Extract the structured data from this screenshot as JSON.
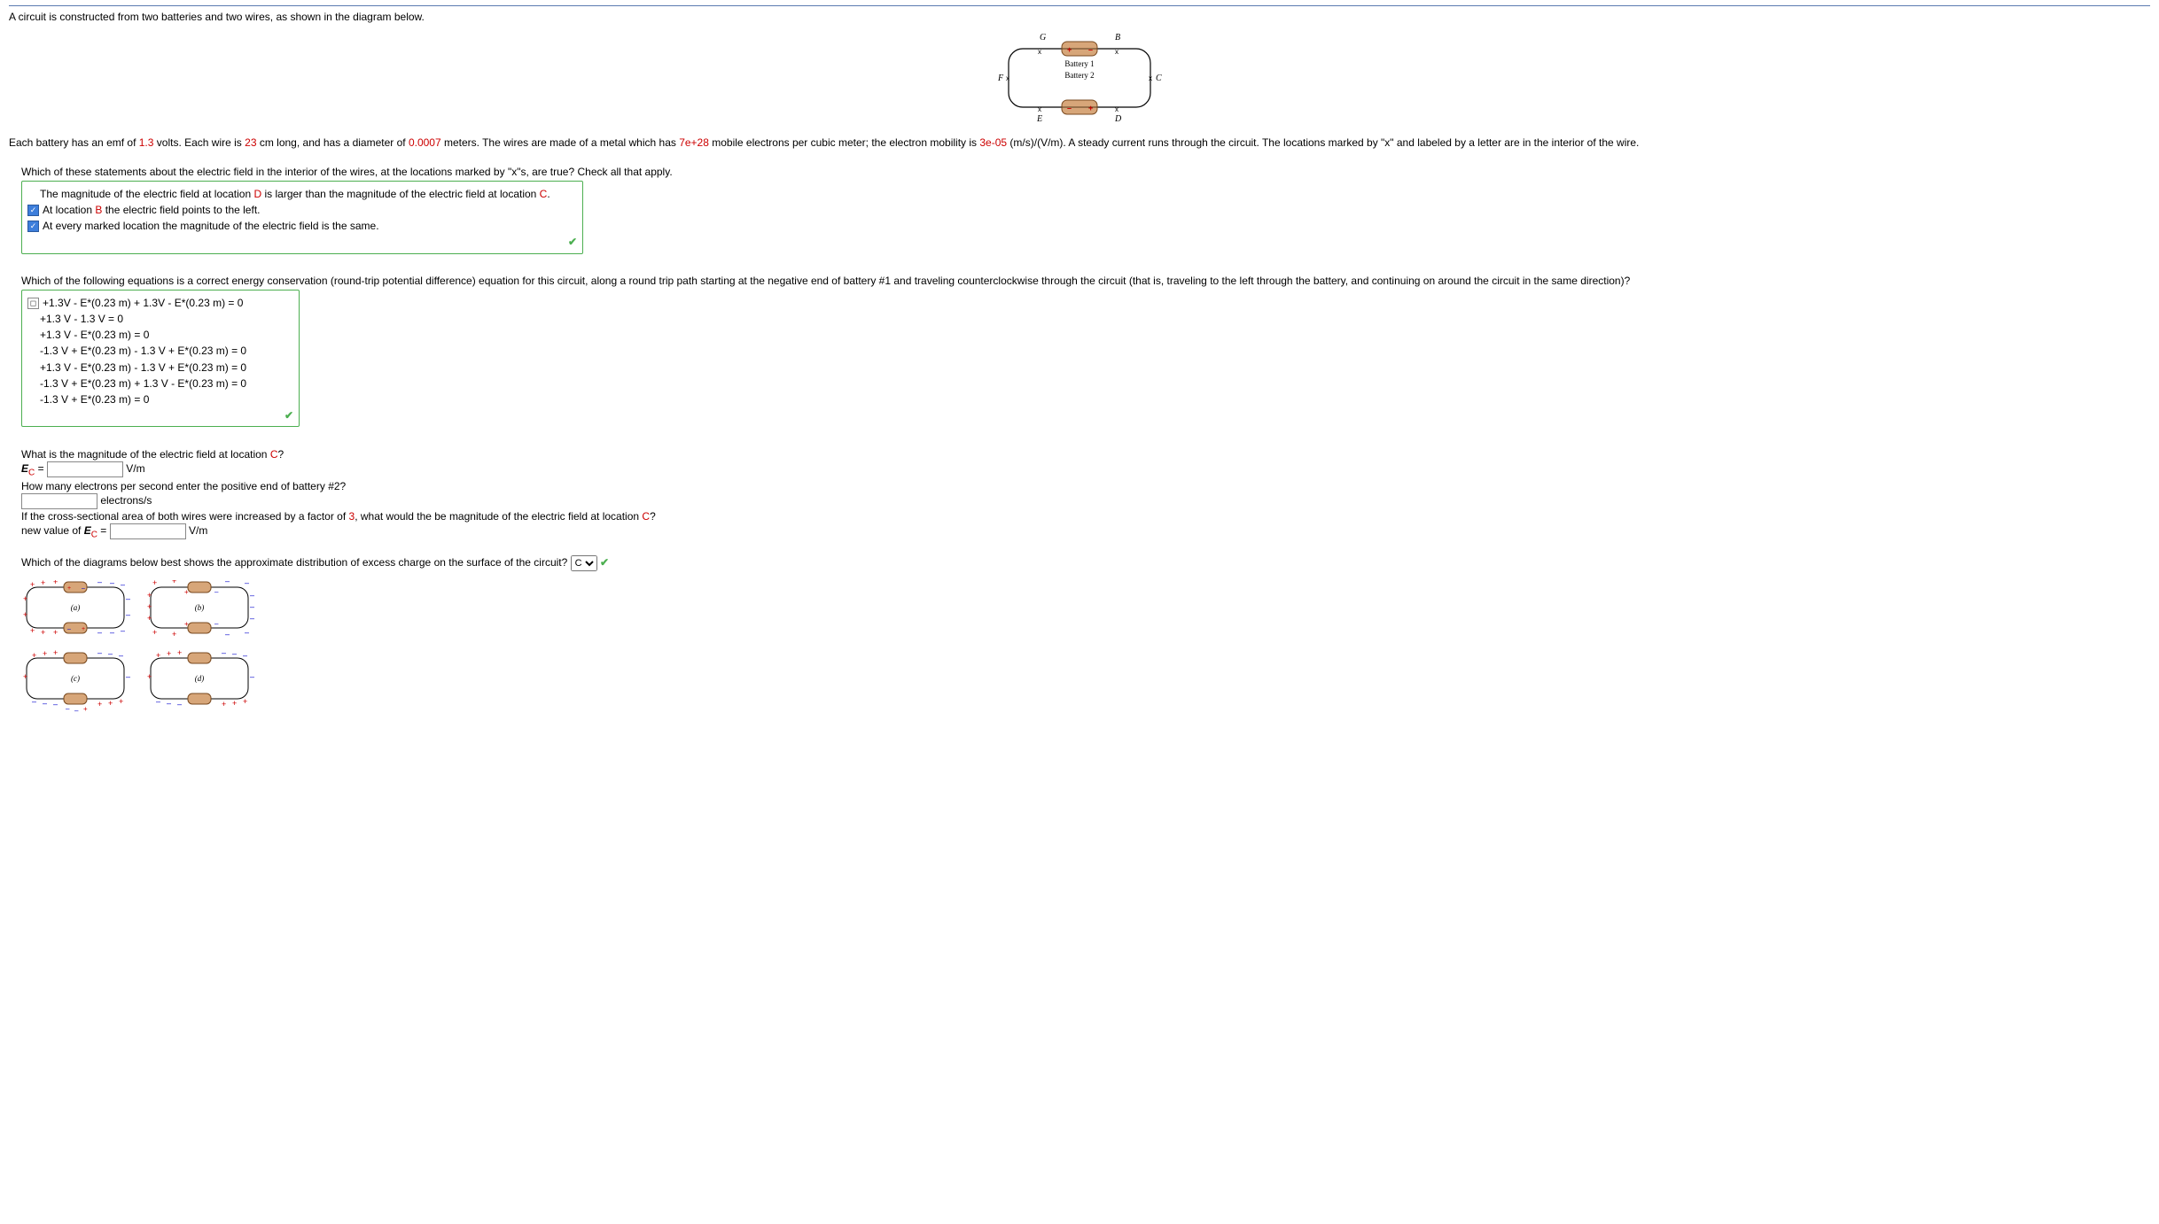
{
  "intro": "A circuit is constructed from two batteries and two wires, as shown in the diagram below.",
  "circuit": {
    "G": "G",
    "B": "B",
    "F": "F",
    "C": "C",
    "E": "E",
    "D": "D",
    "battery1": "Battery 1",
    "battery2": "Battery 2",
    "x": "x",
    "plus": "+",
    "minus": "–"
  },
  "params": {
    "pre_emf": "Each battery has an emf of ",
    "emf": "1.3",
    "post_emf": " volts. Each wire is ",
    "length": "23",
    "post_len": " cm long, and has a diameter of ",
    "diam": "0.0007",
    "post_diam": " meters. The wires are made of a metal which has ",
    "n": "7e+28",
    "post_n": " mobile electrons per cubic meter; the electron mobility is ",
    "mu": "3e-05",
    "post_mu": " (m/s)/(V/m). A steady current runs through the circuit. The locations marked by \"x\" and labeled by a letter are in the interior of the wire."
  },
  "q1": {
    "prompt_a": "Which of these statements about the electric field in the interior of the wires, at the locations marked by \"x\"s, are true? Check all that apply.",
    "opt1_a": "The magnitude of the electric field at location ",
    "opt1_D": "D",
    "opt1_b": " is larger than the magnitude of the electric field at location ",
    "opt1_C": "C",
    "opt1_c": ".",
    "opt2_a": "At location ",
    "opt2_B": "B",
    "opt2_b": " the electric field points to the left.",
    "opt3": "At every marked location the magnitude of the electric field is the same."
  },
  "q2": {
    "prompt": "Which of the following equations is a correct energy conservation (round-trip potential difference) equation for this circuit, along a round trip path starting at the negative end of battery #1 and traveling counterclockwise through the circuit (that is, traveling to the left through the battery, and continuing on around the circuit in the same direction)?",
    "opts": [
      "+1.3V - E*(0.23 m) + 1.3V - E*(0.23 m) = 0",
      "+1.3 V - 1.3 V = 0",
      "+1.3 V - E*(0.23 m) = 0",
      "-1.3 V + E*(0.23 m) - 1.3 V + E*(0.23 m) = 0",
      "+1.3 V - E*(0.23 m) - 1.3 V + E*(0.23 m) = 0",
      "-1.3 V + E*(0.23 m) + 1.3 V - E*(0.23 m) = 0",
      "-1.3 V + E*(0.23 m) = 0"
    ]
  },
  "q3": {
    "prompt_a": "What is the magnitude of the electric field at location ",
    "prompt_C": "C",
    "prompt_b": "?",
    "E_label_a": "E",
    "E_sub": "C",
    "E_label_b": " = ",
    "unit": "V/m",
    "q_electrons": "How many electrons per second enter the positive end of battery #2?",
    "electrons_unit": "electrons/s",
    "q_area_a": "If the cross-sectional area of both wires were increased by a factor of ",
    "q_area_n": "3",
    "q_area_b": ", what would the be magnitude of the electric field at location ",
    "q_area_C": "C",
    "q_area_c": "?",
    "newE_a": "new value of ",
    "newE_b": "E",
    "newE_sub": "C",
    "newE_c": " = "
  },
  "q4": {
    "prompt": "Which of the diagrams below best shows the approximate distribution of excess charge on the surface of the circuit?",
    "selected": "C",
    "labels": {
      "a": "(a)",
      "b": "(b)",
      "c": "(c)",
      "d": "(d)"
    }
  }
}
